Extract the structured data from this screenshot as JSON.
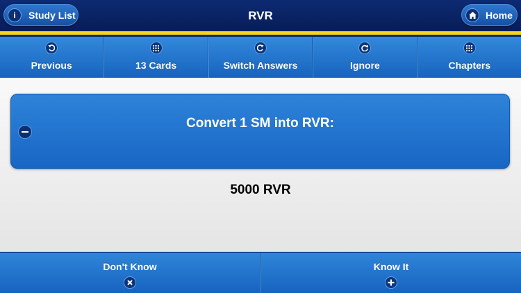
{
  "header": {
    "title": "RVR",
    "left_button": {
      "label": "Study List",
      "icon": "info-icon"
    },
    "right_button": {
      "label": "Home",
      "icon": "home-icon"
    }
  },
  "toolbar": {
    "items": [
      {
        "label": "Previous",
        "icon": "undo-arrow-icon"
      },
      {
        "label": "13 Cards",
        "icon": "grid-icon"
      },
      {
        "label": "Switch Answers",
        "icon": "redo-arrow-icon"
      },
      {
        "label": "Ignore",
        "icon": "refresh-icon"
      },
      {
        "label": "Chapters",
        "icon": "grid-icon"
      }
    ]
  },
  "card": {
    "question": "Convert 1 SM into RVR:",
    "answer": "5000 RVR"
  },
  "bottom": {
    "dont_know": {
      "label": "Don't Know",
      "icon": "close-icon"
    },
    "know_it": {
      "label": "Know It",
      "icon": "plus-icon"
    }
  },
  "colors": {
    "header_bg": "#0d2a73",
    "accent_yellow": "#f7d51c",
    "button_blue": "#1e6fca"
  }
}
